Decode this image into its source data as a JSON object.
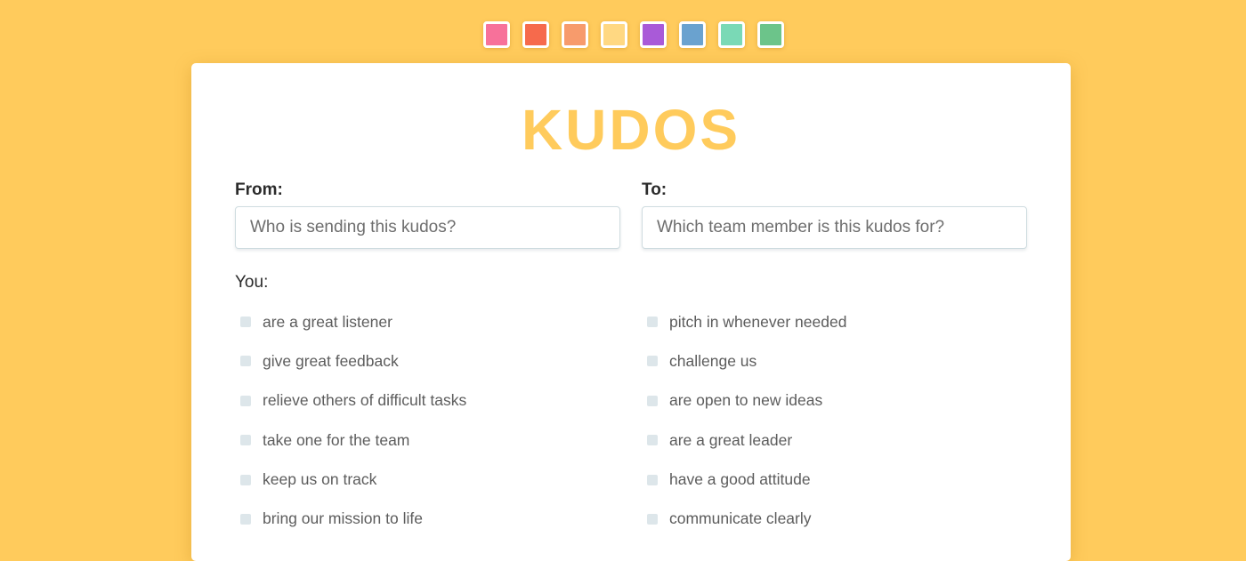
{
  "palette": {
    "swatches": [
      {
        "name": "pink",
        "color": "#f7719a"
      },
      {
        "name": "red-orange",
        "color": "#f66a4c"
      },
      {
        "name": "orange",
        "color": "#f79b6c"
      },
      {
        "name": "yellow",
        "color": "#ffd882"
      },
      {
        "name": "purple",
        "color": "#a95ad8"
      },
      {
        "name": "blue",
        "color": "#6aa2cf"
      },
      {
        "name": "mint",
        "color": "#7ad9b6"
      },
      {
        "name": "green",
        "color": "#6cc48a"
      }
    ]
  },
  "card": {
    "title": "KUDOS",
    "title_color": "#ffcb5c"
  },
  "from": {
    "label": "From:",
    "placeholder": "Who is sending this kudos?",
    "value": ""
  },
  "to": {
    "label": "To:",
    "placeholder": "Which team member is this kudos for?",
    "value": ""
  },
  "you_label": "You:",
  "qualities_left": [
    "are a great listener",
    "give great feedback",
    "relieve others of difficult tasks",
    "take one for the team",
    "keep us on track",
    "bring our mission to life"
  ],
  "qualities_right": [
    "pitch in whenever needed",
    "challenge us",
    "are open to new ideas",
    "are a great leader",
    "have a good attitude",
    "communicate clearly"
  ],
  "colors": {
    "background": "#ffcb5c",
    "card": "#ffffff",
    "checkbox": "#dde6ea"
  }
}
